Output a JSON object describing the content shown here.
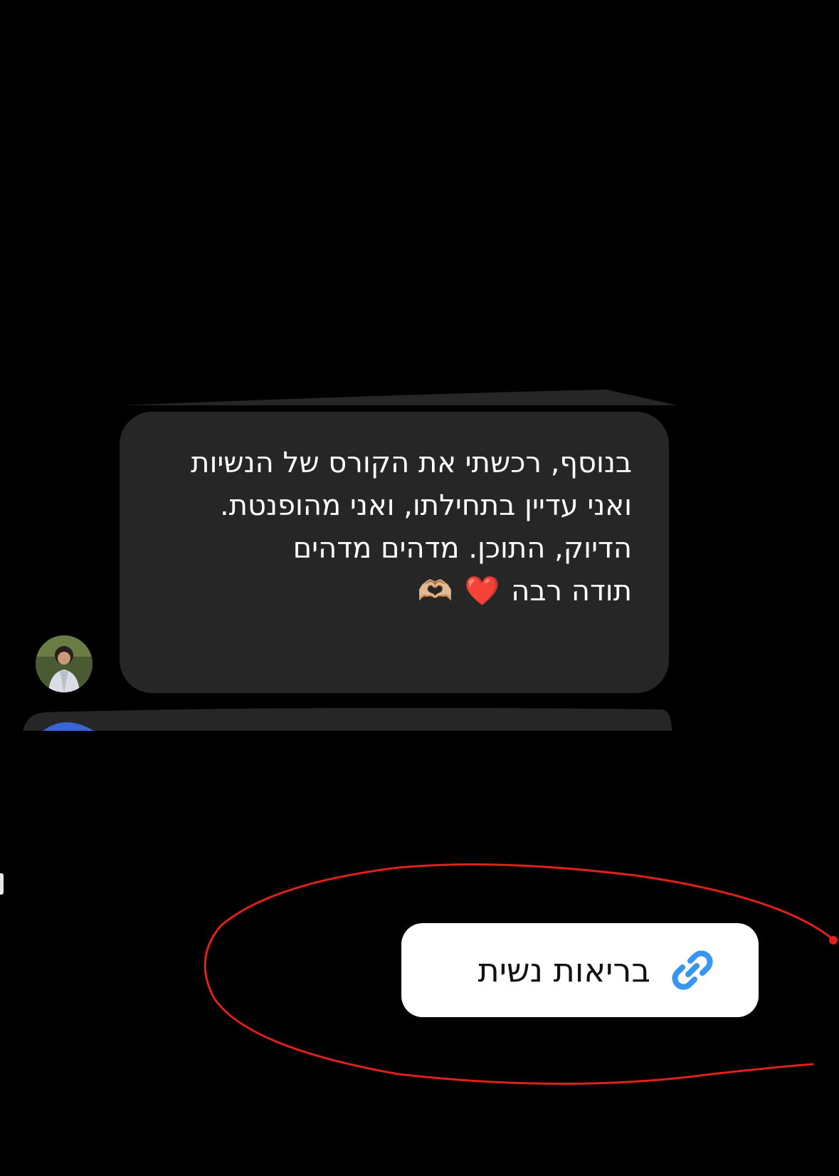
{
  "message": {
    "text": "בנוסף, רכשתי את הקורס של הנשיות ואני עדיין בתחילתו, ואני מהופנטת. הדיוק, התוכן. מדהים מדהים",
    "thanks": "תודה רבה",
    "heart_emoji": "❤️",
    "hands_emoji": "🫶🏼"
  },
  "link_sticker": {
    "label": "בריאות נשית",
    "icon": "link-icon",
    "icon_color": "#3797f0"
  },
  "colors": {
    "background": "#000000",
    "bubble": "#262626",
    "annotation": "#e0201b"
  }
}
